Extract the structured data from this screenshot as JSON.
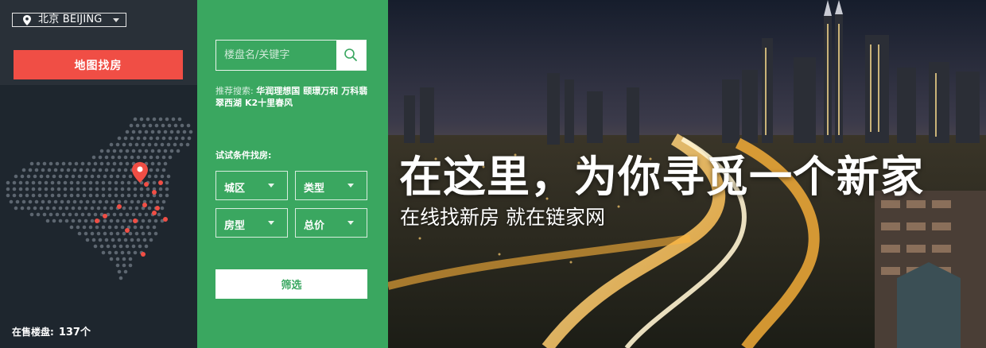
{
  "city_selector": {
    "label": "北京 BEIJING",
    "pin_icon": "location-pin-icon",
    "caret_icon": "caret-down-icon"
  },
  "map_search_button": "地图找房",
  "map_graphic": {
    "icon": "china-dot-map",
    "marker_color": "#f04e45",
    "dot_color": "#5d6670"
  },
  "on_sale": {
    "label": "在售楼盘:",
    "count": "137个"
  },
  "search": {
    "placeholder": "楼盘名/关键字",
    "icon": "search-icon"
  },
  "hot_searches": {
    "label": "推荐搜索:",
    "keywords": [
      "华润理想国",
      "颐璟万和",
      "万科翡翠西湖",
      "K2十里春风"
    ]
  },
  "filter_prompt": "试试条件找房:",
  "filters": [
    {
      "label": "城区"
    },
    {
      "label": "类型"
    },
    {
      "label": "房型"
    },
    {
      "label": "总价"
    }
  ],
  "filter_button": "筛选",
  "hero": {
    "headline": "在这里，为你寻觅一个新家",
    "subline": "在线找新房  就在链家网"
  },
  "colors": {
    "accent_red": "#f04e45",
    "brand_green": "#3aa760",
    "panel_dark": "#1e262e"
  }
}
